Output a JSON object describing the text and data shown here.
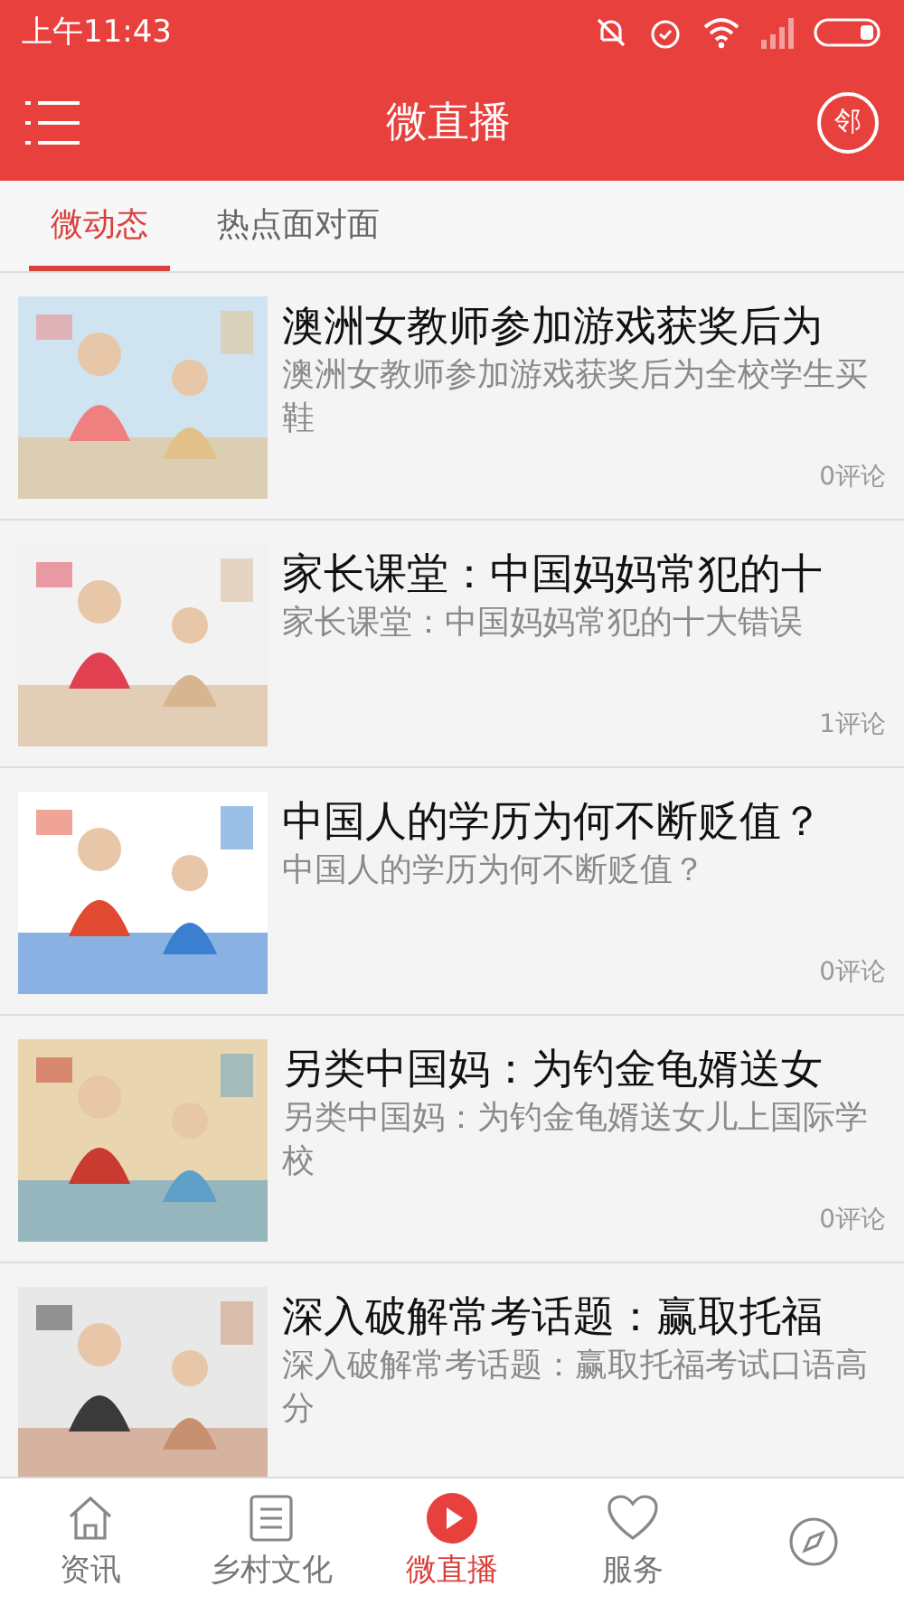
{
  "status_bar": {
    "time": "上午11:43"
  },
  "header": {
    "title": "微直播",
    "badge": "邻"
  },
  "tabs": [
    {
      "label": "微动态",
      "selected": true
    },
    {
      "label": "热点面对面",
      "selected": false
    }
  ],
  "articles": [
    {
      "title": "澳洲女教师参加游戏获奖后为",
      "summary": "澳洲女教师参加游戏获奖后为全校学生买鞋",
      "comments": "0评论"
    },
    {
      "title": "家长课堂：中国妈妈常犯的十",
      "summary": "家长课堂：中国妈妈常犯的十大错误",
      "comments": "1评论"
    },
    {
      "title": "中国人的学历为何不断贬值？",
      "summary": "中国人的学历为何不断贬值？",
      "comments": "0评论"
    },
    {
      "title": "另类中国妈：为钓金龟婿送女",
      "summary": "另类中国妈：为钓金龟婿送女儿上国际学校",
      "comments": "0评论"
    },
    {
      "title": "深入破解常考话题：赢取托福",
      "summary": "深入破解常考话题：赢取托福考试口语高分"
    }
  ],
  "bottom_nav": [
    {
      "label": "资讯",
      "selected": false
    },
    {
      "label": "乡村文化",
      "selected": false
    },
    {
      "label": "微直播",
      "selected": true
    },
    {
      "label": "服务",
      "selected": false
    },
    {
      "selected": false
    }
  ]
}
